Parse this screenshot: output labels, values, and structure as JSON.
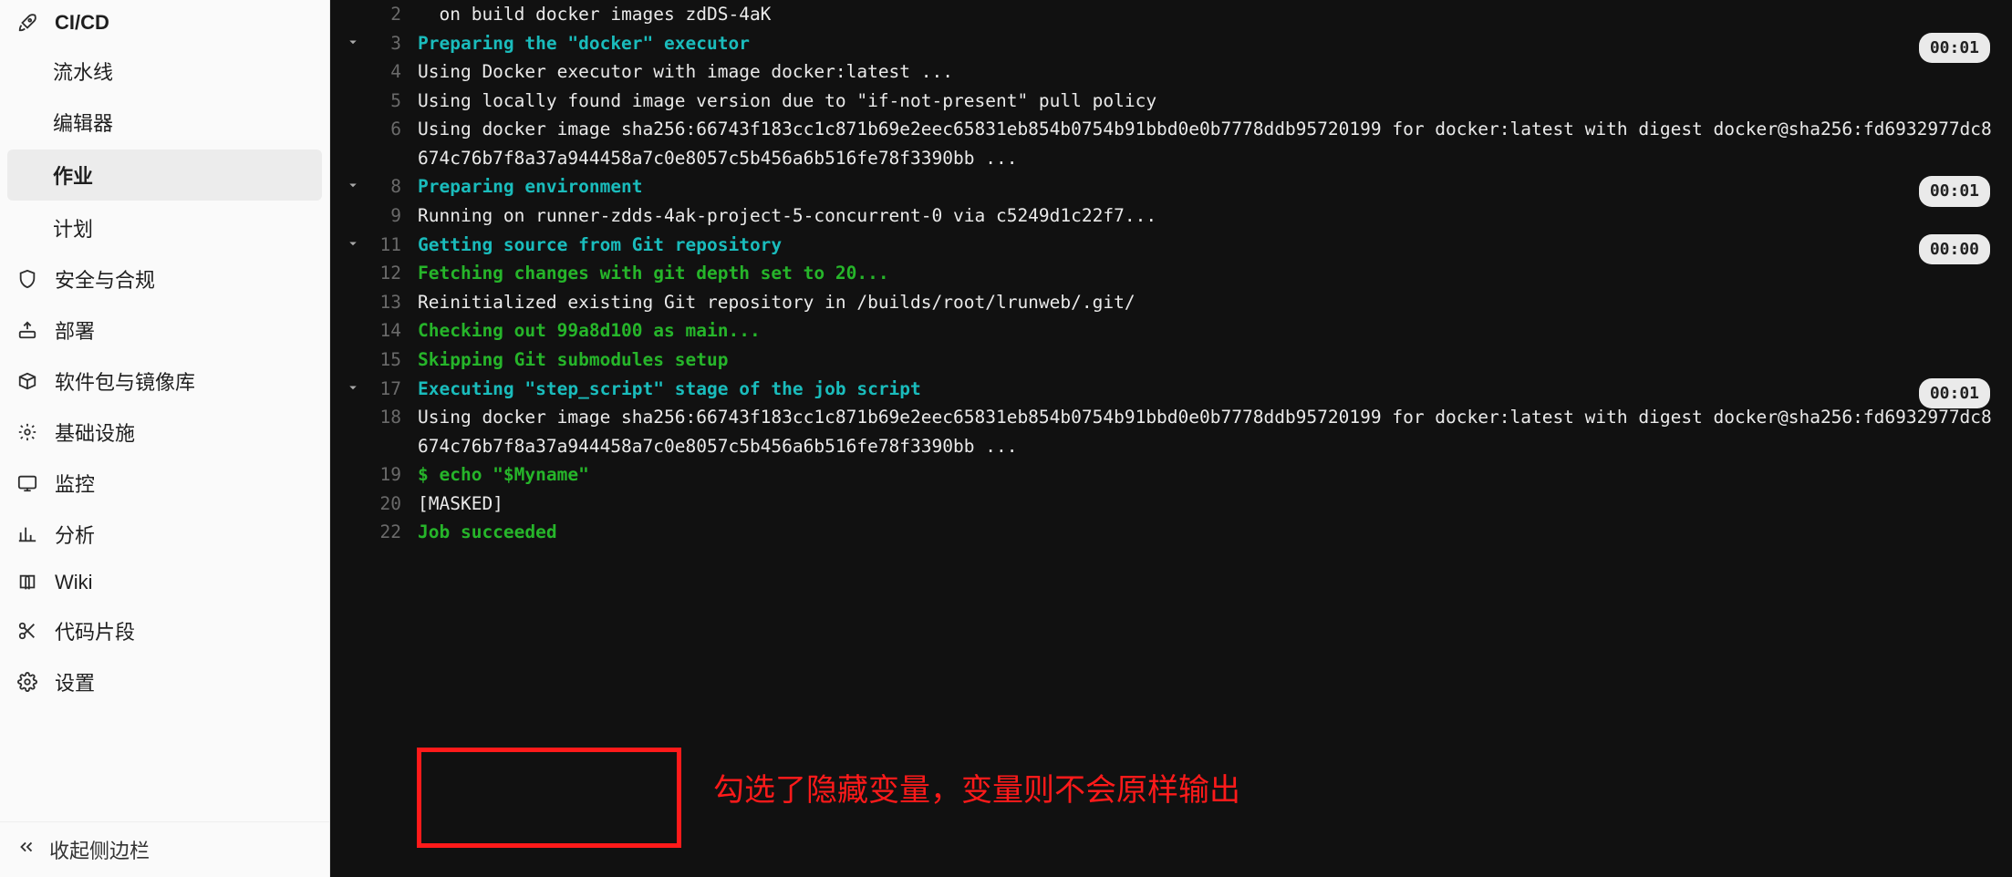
{
  "sidebar": {
    "cicd": "CI/CD",
    "pipelines": "流水线",
    "editor": "编辑器",
    "jobs": "作业",
    "schedules": "计划",
    "security": "安全与合规",
    "deploy": "部署",
    "packages": "软件包与镜像库",
    "infra": "基础设施",
    "monitor": "监控",
    "analytics": "分析",
    "wiki": "Wiki",
    "snippets": "代码片段",
    "settings": "设置",
    "collapse": "收起侧边栏"
  },
  "log": {
    "lines": [
      {
        "n": "2",
        "chev": false,
        "cls": "plain",
        "text": "  on build docker images zdDS-4aK",
        "dur": null
      },
      {
        "n": "3",
        "chev": true,
        "cls": "cyan",
        "text": "Preparing the \"docker\" executor",
        "dur": "00:01"
      },
      {
        "n": "4",
        "chev": false,
        "cls": "plain",
        "text": "Using Docker executor with image docker:latest ...",
        "dur": null
      },
      {
        "n": "5",
        "chev": false,
        "cls": "plain",
        "text": "Using locally found image version due to \"if-not-present\" pull policy",
        "dur": null
      },
      {
        "n": "6",
        "chev": false,
        "cls": "plain",
        "text": "Using docker image sha256:66743f183cc1c871b69e2eec65831eb854b0754b91bbd0e0b7778ddb95720199 for docker:latest with digest docker@sha256:fd6932977dc8674c76b7f8a37a944458a7c0e8057c5b456a6b516fe78f3390bb ...",
        "dur": null
      },
      {
        "n": "8",
        "chev": true,
        "cls": "cyan",
        "text": "Preparing environment",
        "dur": "00:01"
      },
      {
        "n": "9",
        "chev": false,
        "cls": "plain",
        "text": "Running on runner-zdds-4ak-project-5-concurrent-0 via c5249d1c22f7...",
        "dur": null
      },
      {
        "n": "11",
        "chev": true,
        "cls": "cyan",
        "text": "Getting source from Git repository",
        "dur": "00:00"
      },
      {
        "n": "12",
        "chev": false,
        "cls": "green",
        "text": "Fetching changes with git depth set to 20...",
        "dur": null
      },
      {
        "n": "13",
        "chev": false,
        "cls": "plain",
        "text": "Reinitialized existing Git repository in /builds/root/lrunweb/.git/",
        "dur": null
      },
      {
        "n": "14",
        "chev": false,
        "cls": "green",
        "text": "Checking out 99a8d100 as main...",
        "dur": null
      },
      {
        "n": "15",
        "chev": false,
        "cls": "green",
        "text": "Skipping Git submodules setup",
        "dur": null
      },
      {
        "n": "17",
        "chev": true,
        "cls": "cyan",
        "text": "Executing \"step_script\" stage of the job script",
        "dur": "00:01"
      },
      {
        "n": "18",
        "chev": false,
        "cls": "plain",
        "text": "Using docker image sha256:66743f183cc1c871b69e2eec65831eb854b0754b91bbd0e0b7778ddb95720199 for docker:latest with digest docker@sha256:fd6932977dc8674c76b7f8a37a944458a7c0e8057c5b456a6b516fe78f3390bb ...",
        "dur": null
      },
      {
        "n": "19",
        "chev": false,
        "cls": "green",
        "text": "$ echo \"$Myname\"",
        "dur": null
      },
      {
        "n": "20",
        "chev": false,
        "cls": "plain",
        "text": "[MASKED]",
        "dur": null
      },
      {
        "n": "22",
        "chev": false,
        "cls": "green",
        "text": "Job succeeded",
        "dur": null
      }
    ]
  },
  "annotation": {
    "text": "勾选了隐藏变量，变量则不会原样输出"
  }
}
